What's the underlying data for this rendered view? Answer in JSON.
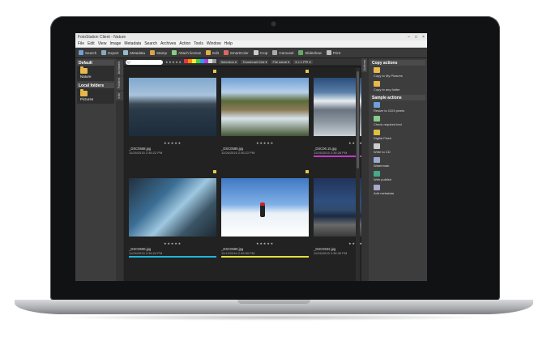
{
  "window": {
    "title": "FotoStation Client - Nature",
    "controls": [
      "–",
      "□",
      "×"
    ]
  },
  "menu": [
    "File",
    "Edit",
    "View",
    "Image",
    "Metadata",
    "Search",
    "Archives",
    "Action",
    "Tools",
    "Window",
    "Help"
  ],
  "toolbar": [
    {
      "label": "Search",
      "icon": "search-icon",
      "color": "#6fa0d8"
    },
    {
      "label": "Export",
      "icon": "export-icon",
      "color": "#8ab"
    },
    {
      "label": "Metadata",
      "icon": "metadata-icon",
      "color": "#9bc"
    },
    {
      "label": "Stamp",
      "icon": "stamp-icon",
      "color": "#d9a44c"
    },
    {
      "label": "Attach license",
      "icon": "license-icon",
      "color": "#8c8"
    },
    {
      "label": "Edit",
      "icon": "edit-icon",
      "color": "#e0b040"
    },
    {
      "label": "SmartColor",
      "icon": "smartcolor-icon",
      "color": "#d66"
    },
    {
      "label": "Crop",
      "icon": "crop-icon",
      "color": "#ccc"
    },
    {
      "label": "Carousel",
      "icon": "carousel-icon",
      "color": "#aaa"
    },
    {
      "label": "Slideshow",
      "icon": "slideshow-icon",
      "color": "#6a6"
    },
    {
      "label": "Print",
      "icon": "print-icon",
      "color": "#bbb"
    }
  ],
  "left_panel": {
    "sections": [
      {
        "title": "Default",
        "items": [
          {
            "label": "Nature"
          }
        ]
      },
      {
        "title": "Local folders",
        "items": [
          {
            "label": "Pictures"
          }
        ]
      }
    ],
    "tabs": [
      "Archives",
      "Folders",
      "Info"
    ]
  },
  "filterbar": {
    "search_placeholder": "Q~",
    "stars": "★★★★★",
    "swatches": [
      "#e34",
      "#f80",
      "#ee3",
      "#4c4",
      "#39f",
      "#a4d",
      "#ddd",
      "#999"
    ],
    "selection": "Selection ▾",
    "view": "Thumbnail Grid ▾",
    "sort": "File name ▾",
    "zoom": "3 x 1 PPI ▾"
  },
  "thumbnails": [
    {
      "name": "_DSC0568.jpg",
      "date": "11/26/2015 2:36:22 PM",
      "bar_color": "",
      "scene": "lake"
    },
    {
      "name": "_DSC0589.jpg",
      "date": "11/26/2015 2:36:22 PM",
      "bar_color": "",
      "scene": "river"
    },
    {
      "name": "_DSC06.15.jpg",
      "date": "11/26/2015 2:36:28 PM",
      "bar_color": "#c33bc9",
      "scene": "mountains"
    },
    {
      "name": "_DSC0600.jpg",
      "date": "11/26/2015 2:36:24 PM",
      "bar_color": "#22b4d9",
      "scene": "stream"
    },
    {
      "name": "_DSC0690.jpg",
      "date": "11/13/2016 2:35:50 PM",
      "bar_color": "#e0e040",
      "scene": "snow"
    },
    {
      "name": "_DSC0632.jpg",
      "date": "11/26/2015 2:36:30 PM",
      "bar_color": "",
      "scene": "shore"
    }
  ],
  "thumb_stars": "★★★★★",
  "right_panel": {
    "tabs": [
      "Actions"
    ],
    "sections": [
      {
        "title": "Copy actions",
        "items": [
          {
            "label": "Copy to My Pictures",
            "color": "#e7b84a"
          },
          {
            "label": "Copy to any folder",
            "color": "#e7b84a"
          }
        ]
      },
      {
        "title": "Sample actions",
        "items": [
          {
            "label": "Resize to 1024 pixels",
            "color": "#6fa0d8"
          },
          {
            "label": "Check required text",
            "color": "#8c8"
          },
          {
            "label": "Digital Flash",
            "color": "#e0c040"
          },
          {
            "label": "Write to CD",
            "color": "#ccc"
          },
          {
            "label": "Watermark",
            "color": "#9ac"
          },
          {
            "label": "Web publish",
            "color": "#4a8"
          },
          {
            "label": "Add metadata",
            "color": "#aac"
          }
        ]
      }
    ]
  }
}
